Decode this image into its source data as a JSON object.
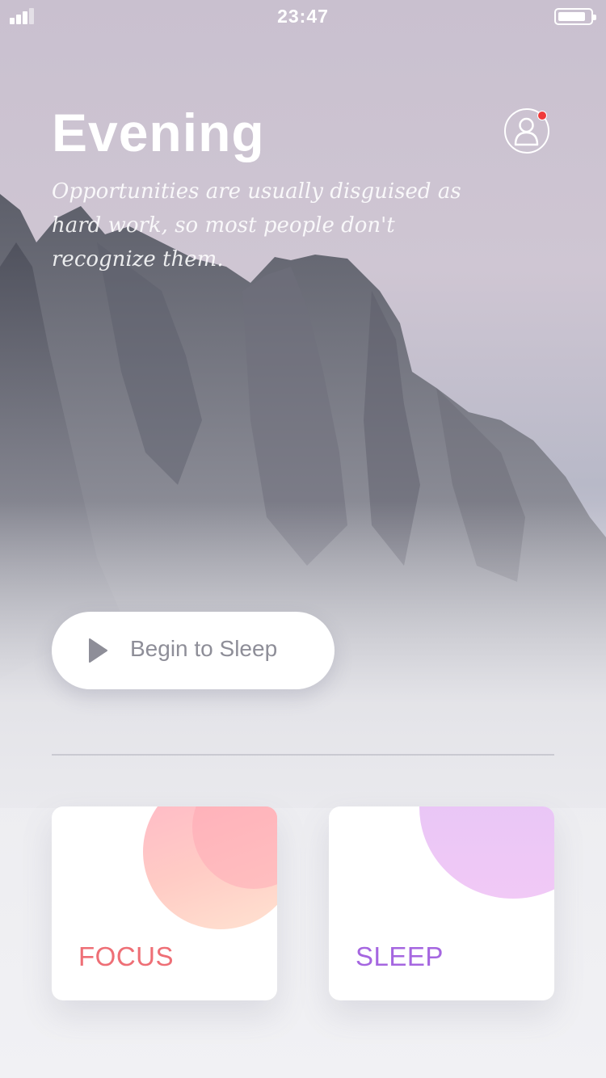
{
  "status_bar": {
    "time": "23:47"
  },
  "header": {
    "title": "Evening",
    "quote": "Opportunities are usually disguised as hard work, so most people don't recognize them."
  },
  "profile": {
    "icon": "user-icon",
    "notification": true,
    "notification_color": "#f03a3a"
  },
  "main_button": {
    "label": "Begin to Sleep",
    "icon": "play-icon"
  },
  "cards": [
    {
      "label": "FOCUS",
      "color": "#ee6f76"
    },
    {
      "label": "SLEEP",
      "color": "#a566e0"
    }
  ]
}
